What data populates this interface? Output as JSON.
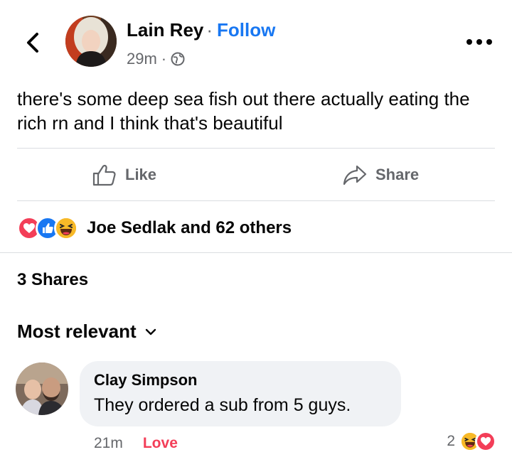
{
  "post": {
    "author": "Lain Rey",
    "separator": "·",
    "follow_label": "Follow",
    "time": "29m",
    "time_separator": "·",
    "text": "there's some deep sea fish out there actually eating the rich rn and I think that's beautiful"
  },
  "actions": {
    "like_label": "Like",
    "share_label": "Share"
  },
  "reactions": {
    "summary": "Joe Sedlak and 62 others",
    "icons": [
      "love-reaction",
      "like-reaction",
      "haha-reaction"
    ]
  },
  "shares": {
    "label": "3 Shares"
  },
  "comments": {
    "sort_label": "Most relevant",
    "items": [
      {
        "author": "Clay Simpson",
        "text": "They ordered a sub from 5 guys.",
        "time": "21m",
        "reaction_label": "Love",
        "reaction_count": "2"
      }
    ]
  },
  "colors": {
    "accent": "#1877f2",
    "love": "#f33e58",
    "haha": "#f7b928",
    "muted": "#65676b",
    "bubble": "#f0f2f5"
  }
}
